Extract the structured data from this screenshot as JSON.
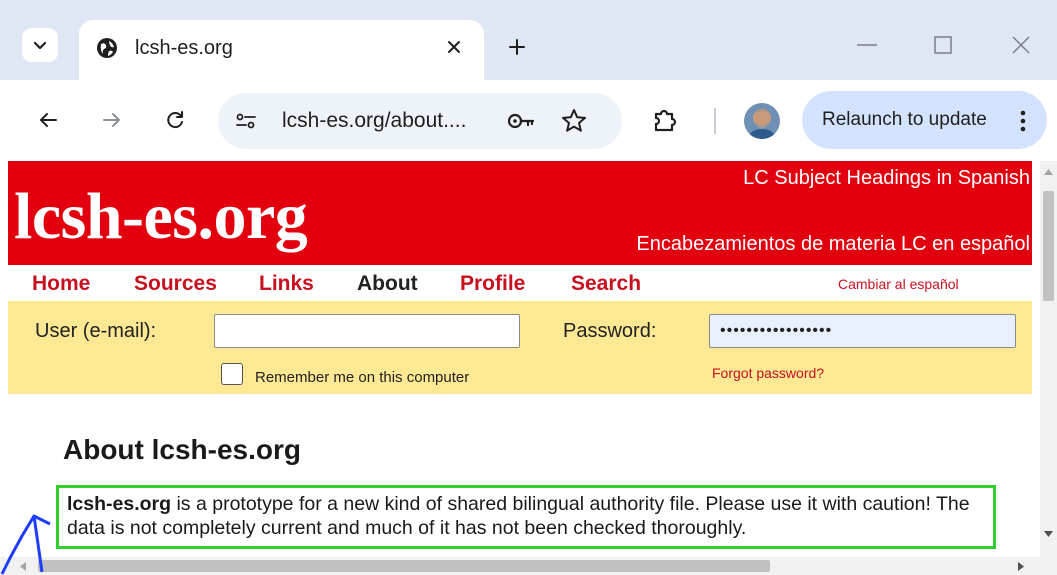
{
  "browser": {
    "tab": {
      "title": "lcsh-es.org",
      "icon": "globe-icon"
    },
    "address_bar": {
      "url": "lcsh-es.org/about...."
    },
    "relaunch_label": "Relaunch to update"
  },
  "site": {
    "logo": "lcsh-es.org",
    "tagline_en": "LC Subject Headings in Spanish",
    "tagline_es": "Encabezamientos de materia LC en español",
    "banner_color": "#e2000e",
    "menu": [
      {
        "label": "Home"
      },
      {
        "label": "Sources"
      },
      {
        "label": "Links"
      },
      {
        "label": "About",
        "current": true
      },
      {
        "label": "Profile"
      },
      {
        "label": "Search"
      }
    ],
    "language_link": "Cambiar al español",
    "login": {
      "user_label": "User (e-mail):",
      "user_value": "",
      "password_label": "Password:",
      "password_value": "•••••••••••••••••",
      "remember_label": "Remember me on this computer",
      "remember_checked": false,
      "forgot_label": "Forgot password?"
    },
    "about": {
      "heading": "About lcsh-es.org",
      "intro_name": "lcsh-es.org",
      "intro_text": " is a prototype for a new kind of shared bilingual authority file. Please use it with caution! The data is not completely current and much of it has not been checked thoroughly.",
      "highlight_color": "#2fd02f"
    }
  }
}
